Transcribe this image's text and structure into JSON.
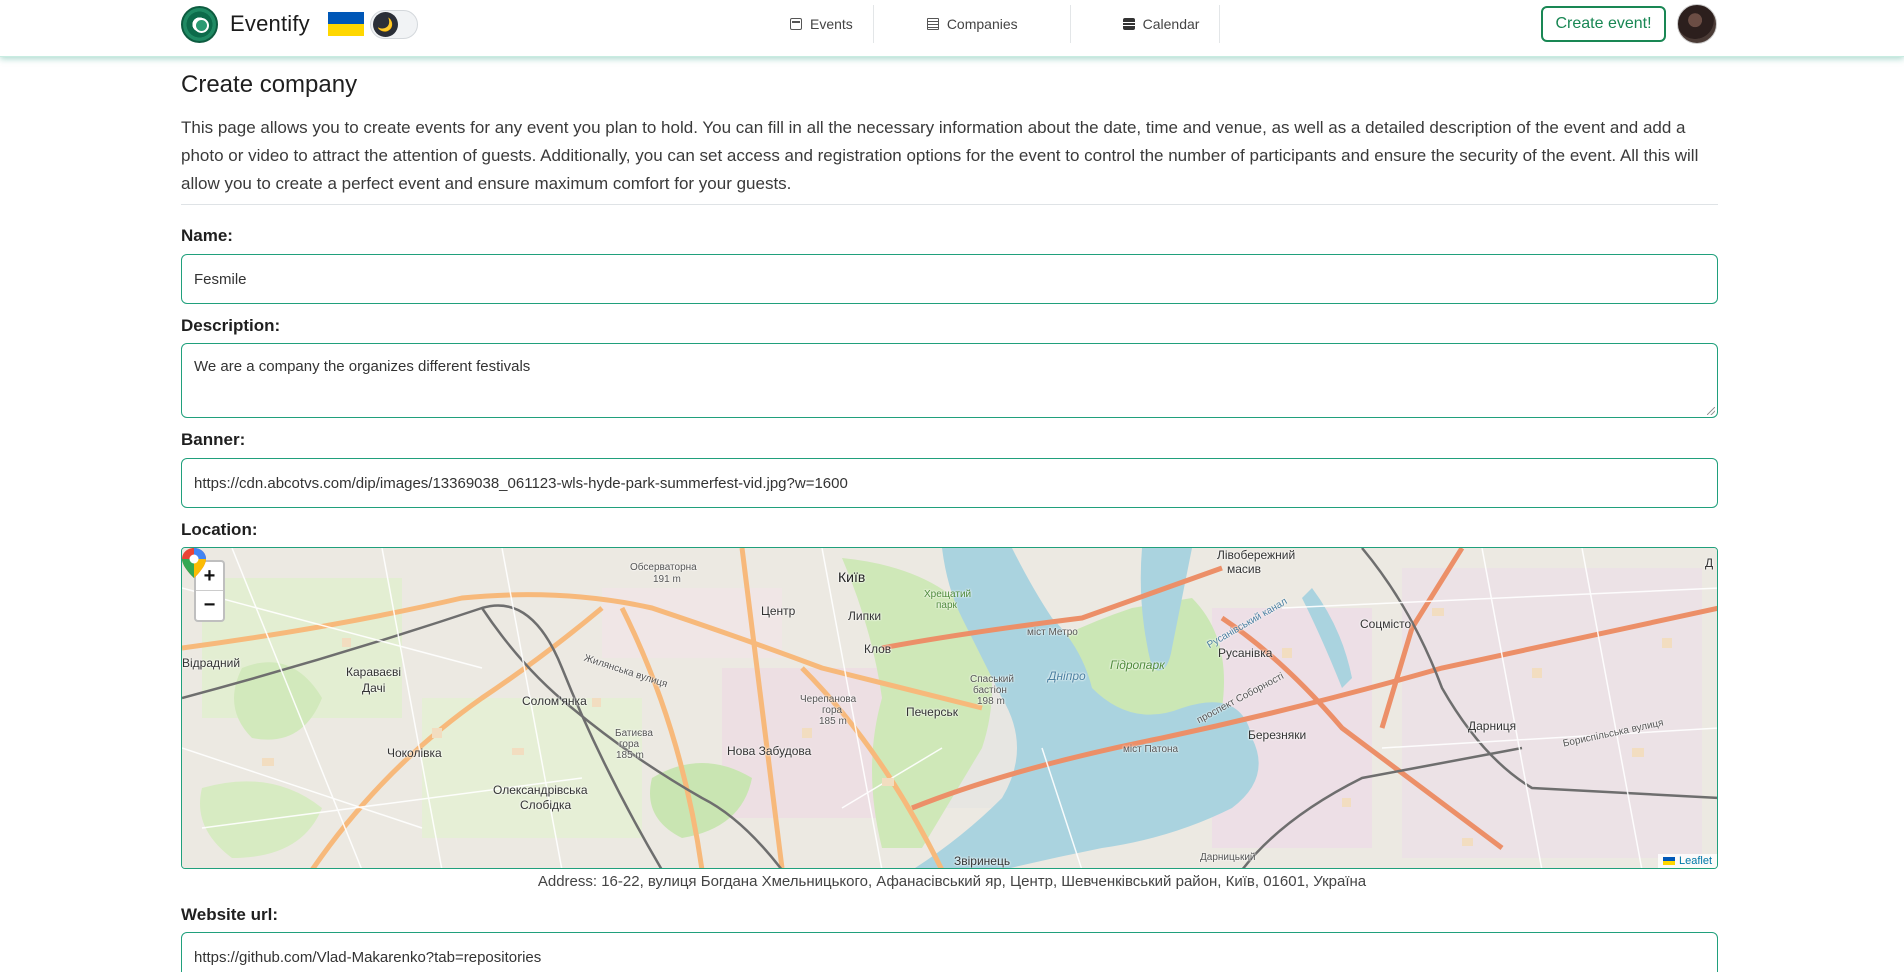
{
  "navbar": {
    "brand": "Eventify",
    "theme_toggle_icon": "🌙",
    "links": [
      {
        "label": "Events",
        "icon": "calendar-icon"
      },
      {
        "label": "Companies",
        "icon": "building-icon"
      },
      {
        "label": "Calendar",
        "icon": "calendar-alt-icon"
      }
    ],
    "create_button": "Create event!"
  },
  "page": {
    "title": "Create company",
    "intro": "This page allows you to create events for any event you plan to hold. You can fill in all the necessary information about the date, time and venue, as well as a detailed description of the event and add a photo or video to attract the attention of guests. Additionally, you can set access and registration options for the event to control the number of participants and ensure the security of the event. All this will allow you to create a perfect event and ensure maximum comfort for your guests."
  },
  "form": {
    "name_label": "Name:",
    "name_value": "Fesmile",
    "description_label": "Description:",
    "description_value": "We are a company the organizes different festivals",
    "banner_label": "Banner:",
    "banner_value": "https://cdn.abcotvs.com/dip/images/13369038_061123-wls-hyde-park-summerfest-vid.jpg?w=1600",
    "location_label": "Location:",
    "website_label": "Website url:",
    "website_value": "https://github.com/Vlad-Makarenko?tab=repositories"
  },
  "map": {
    "zoom_in": "+",
    "zoom_out": "−",
    "attribution": "Leaflet",
    "labels": {
      "kyiv": "Київ",
      "centre": "Центр",
      "lypky": "Липки",
      "klov": "Клов",
      "pechersk": "Печерськ",
      "solomianka": "Солом'янка",
      "karavaievi": "Караваєві",
      "dachi": "Дачі",
      "vidradnyi": "Відрадний",
      "chokolivka": "Чоколівка",
      "oleksandrivska": "Олександрівська",
      "slobidka": "Слобідка",
      "nova_zabudova": "Нова Забудова",
      "zvirynets": "Звіринець",
      "observatory": "Обсерваторна",
      "observatory_h": "191 m",
      "cherepanova": "Черепанова",
      "cherepanova2": "гора",
      "cherepanova_h": "185 m",
      "batyeva": "Батиєва",
      "batyeva2": "гора",
      "batyeva_h": "185 m",
      "spaskyi": "Спаський",
      "spaskyi2": "бастіон",
      "spaskyi_h": "198 m",
      "khreshchatyi": "Хрещатий",
      "khreshchatyi2": "парк",
      "metro_bridge": "міст Метро",
      "paton_bridge": "міст Патона",
      "hidropark": "Гідропарк",
      "dnipro": "Дніпро",
      "livoberezhnyi": "Лівобережний",
      "masyv": "масив",
      "rusanivka": "Русанівка",
      "sotsmisto": "Соцмісто",
      "bereznyaky": "Березняки",
      "darnytsia": "Дарниця",
      "darnytskyi": "Дарницький",
      "edge_d": "Д",
      "vul_zhylianska": "Жилянська вулиця",
      "prosp_soborn": "проспект Соборності",
      "boryspilska": "Бориспільська вулиця",
      "rusanivskyi_kanal": "Русанівський канал"
    }
  },
  "address": "Address: 16-22, вулиця Богдана Хмельницького, Афанасівський яр, Центр, Шевченківський район, Київ, 01601, Україна"
}
